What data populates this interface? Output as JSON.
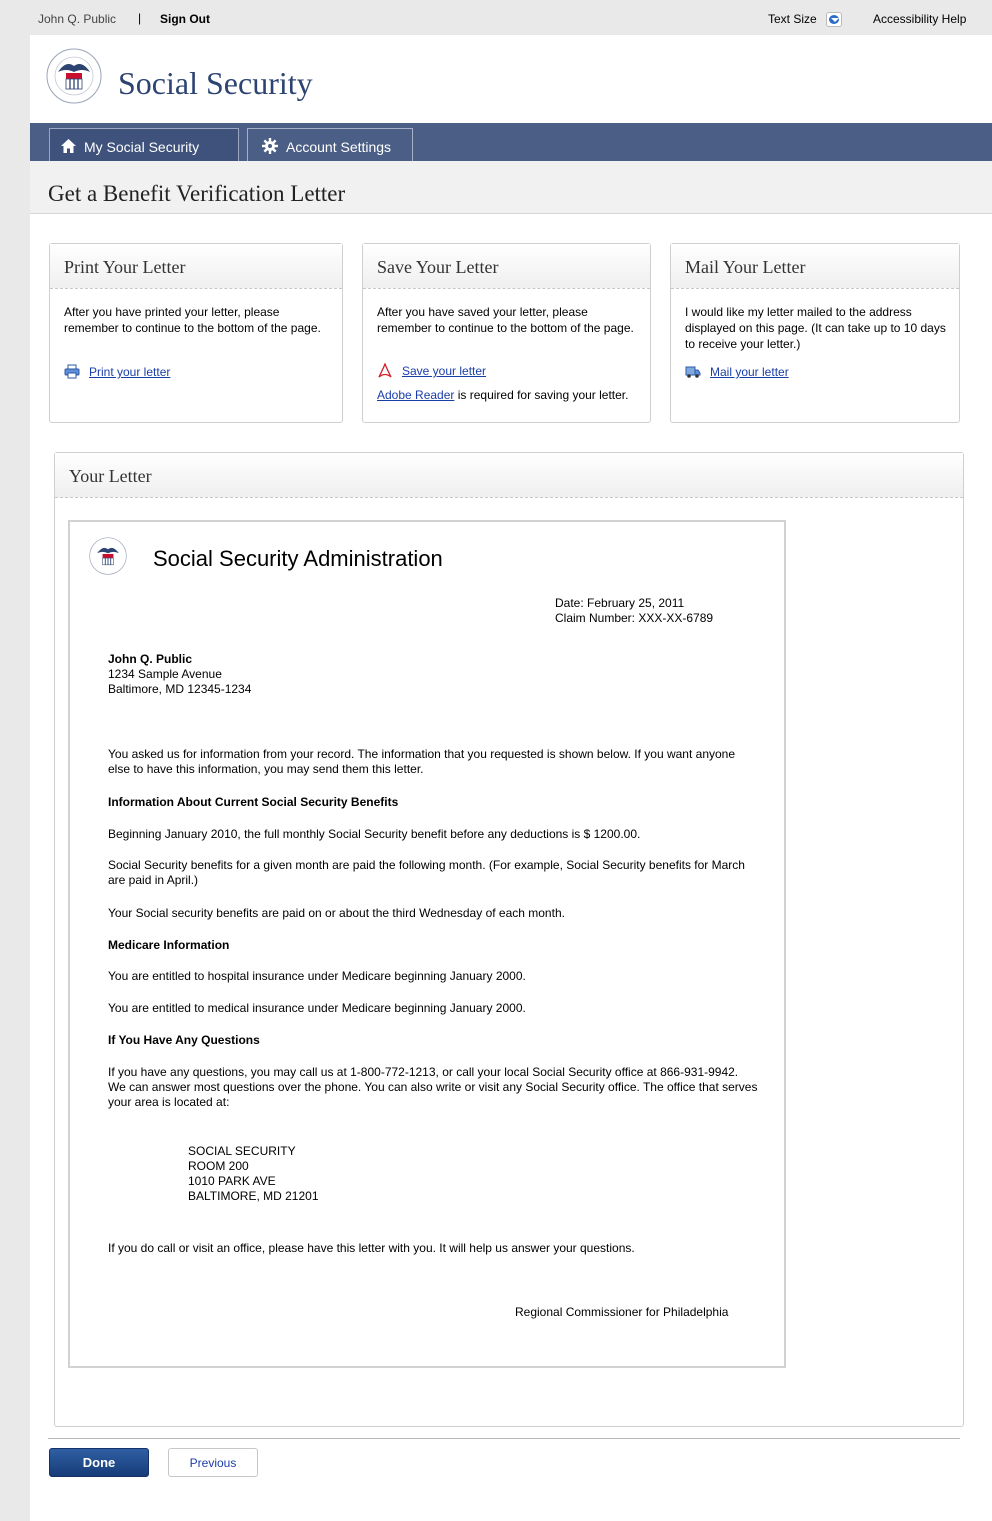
{
  "topbar": {
    "user_name": "John Q. Public",
    "separator": "|",
    "sign_out": "Sign Out",
    "text_size": "Text Size",
    "accessibility_help": "Accessibility Help"
  },
  "header": {
    "brand": "Social Security",
    "seal_text": "SOCIAL SECURITY ADMINISTRATION USA"
  },
  "nav": {
    "tabs": [
      {
        "label": "My Social Security",
        "icon": "home-icon",
        "active": true
      },
      {
        "label": "Account Settings",
        "icon": "gear-icon",
        "active": false
      }
    ]
  },
  "page": {
    "title": "Get a Benefit Verification Letter"
  },
  "cards": {
    "print": {
      "title": "Print Your Letter",
      "body": "After you have printed your letter, please remember to continue to the bottom of the page.",
      "link": "Print your letter",
      "icon": "printer-icon"
    },
    "save": {
      "title": "Save Your Letter",
      "body": "After you have saved your letter, please remember to continue to the bottom of the page.",
      "link": "Save your letter",
      "icon": "pdf-icon",
      "adobe_link": "Adobe Reader",
      "adobe_text": " is required for saving your letter."
    },
    "mail": {
      "title": "Mail Your Letter",
      "body": "I would like my letter mailed to the address displayed on this page. (It can take up to 10 days to receive your letter.)",
      "link": "Mail your letter",
      "icon": "mail-truck-icon"
    }
  },
  "letter_panel": {
    "title": "Your Letter"
  },
  "letter": {
    "org": "Social Security Administration",
    "date_line": "Date:  February 25, 2011",
    "claim_line": "Claim Number:  XXX-XX-6789",
    "recipient": {
      "name": "John Q. Public",
      "street": "1234 Sample Avenue",
      "city": "Baltimore, MD 12345-1234"
    },
    "intro": "You asked us for information from your record.  The information that you requested is shown below.  If you want anyone else to have this information, you may send them this letter.",
    "heading_benefits": "Information About Current Social Security Benefits",
    "benefit_amount": "Beginning January 2010, the full monthly Social Security benefit before any deductions is $ 1200.00.",
    "benefit_timing": "Social Security benefits for a given month are paid the following month.  (For example, Social Security benefits for March are paid in April.)",
    "benefit_day": "Your Social security benefits are paid on or about the third Wednesday of each month.",
    "heading_medicare": "Medicare Information",
    "medicare_hospital": "You are entitled to hospital insurance under Medicare beginning January 2000.",
    "medicare_medical": "You are entitled to medical insurance under Medicare beginning January 2000.",
    "heading_questions": "If You Have Any Questions",
    "questions_text": "If you have any questions, you may call us at 1-800-772-1213, or call your local Social Security office at 866-931-9942.  We can answer most questions over the phone.  You can also write or visit any Social Security office.  The office that serves your area is located at:",
    "office": {
      "line1": "SOCIAL SECURITY",
      "line2": "ROOM 200",
      "line3": "1010 PARK AVE",
      "line4": "BALTIMORE, MD 21201"
    },
    "closing": "If you do call or visit an office, please have this letter with you.  It will help us answer your questions.",
    "signature": "Regional Commissioner for Philadelphia"
  },
  "actions": {
    "done": "Done",
    "previous": "Previous"
  },
  "colors": {
    "nav_bar": "#4b5f86",
    "brand_text": "#2d4473",
    "link": "#1a3ea8",
    "done_button": "#1f4a8a"
  }
}
